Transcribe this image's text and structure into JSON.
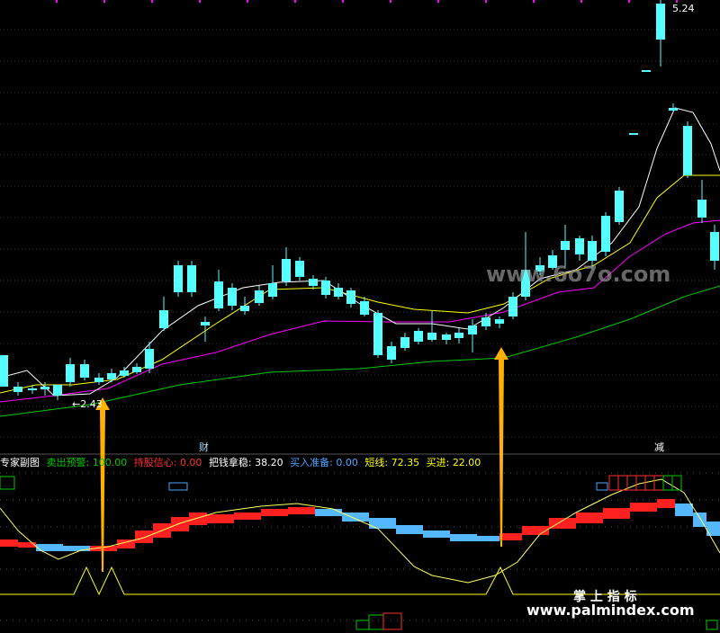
{
  "chart_data": {
    "type": "candlestick",
    "main": {
      "max_label": "5.24",
      "min_label": "2.43",
      "markers": [
        "财",
        "减"
      ]
    },
    "sub": {
      "name": "专家副图",
      "indicators": [
        {
          "label": "卖出预警:",
          "value": "100.00",
          "color": "#00c800"
        },
        {
          "label": "持股信心:",
          "value": "0.00",
          "color": "#ff3030"
        },
        {
          "label": "把钱拿稳:",
          "value": "38.20",
          "color": "#ffffff"
        },
        {
          "label": "买入准备:",
          "value": "0.00",
          "color": "#4aa8ff"
        },
        {
          "label": "短线:",
          "value": "72.35",
          "color": "#ffff00"
        },
        {
          "label": "买进:",
          "value": "22.00",
          "color": "#ffff00"
        }
      ]
    },
    "colors": {
      "up": "#ff3232",
      "down": "#54ffff",
      "ma5": "#ffffff",
      "ma10": "#ffff00",
      "ma20": "#ff00ff",
      "ma60": "#00c800",
      "arrow": "#ffb000"
    }
  },
  "watermark": {
    "site1": "www.6o7o.com",
    "site2_title": "掌 上 指 标",
    "site2_url": "www.palmindex.com"
  }
}
